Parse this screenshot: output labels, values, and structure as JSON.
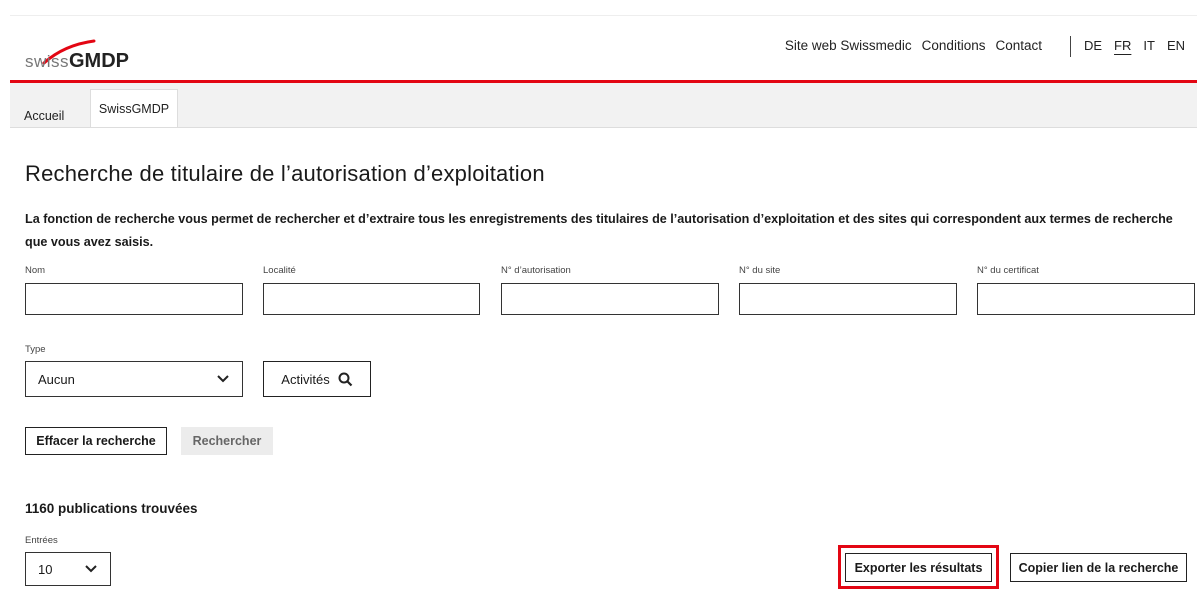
{
  "brand": {
    "logo_prefix": "swiss",
    "logo_name": "GMDP"
  },
  "topnav": {
    "website": "Site web Swissmedic",
    "conditions": "Conditions",
    "contact": "Contact"
  },
  "languages": {
    "de": "DE",
    "fr": "FR",
    "it": "IT",
    "en": "EN",
    "active": "FR"
  },
  "breadcrumb": {
    "home": "Accueil",
    "current": "SwissGMDP"
  },
  "page": {
    "title": "Recherche de titulaire de l’autorisation d’exploitation",
    "intro": "La fonction de recherche vous permet de rechercher et d’extraire tous les enregistrements des titulaires de l’autorisation d’exploitation et des sites qui correspondent aux termes de recherche que vous avez saisis."
  },
  "filters": {
    "nom_label": "Nom",
    "nom_value": "",
    "localite_label": "Localité",
    "localite_value": "",
    "autorisation_label": "N° d’autorisation",
    "autorisation_value": "",
    "site_label": "N° du site",
    "site_value": "",
    "certificat_label": "N° du certificat",
    "certificat_value": "",
    "type_label": "Type",
    "type_value": "Aucun",
    "activities_label": "Activités"
  },
  "actions": {
    "clear": "Effacer la recherche",
    "search": "Rechercher"
  },
  "results": {
    "count_text": "1160 publications trouvées",
    "entries_label": "Entrées",
    "entries_value": "10",
    "export": "Exporter les résultats",
    "copy_link": "Copier lien de la recherche"
  },
  "colors": {
    "accent_red": "#e30613"
  },
  "icons": {
    "search": "search-icon",
    "chevron": "chevron-down-icon"
  }
}
